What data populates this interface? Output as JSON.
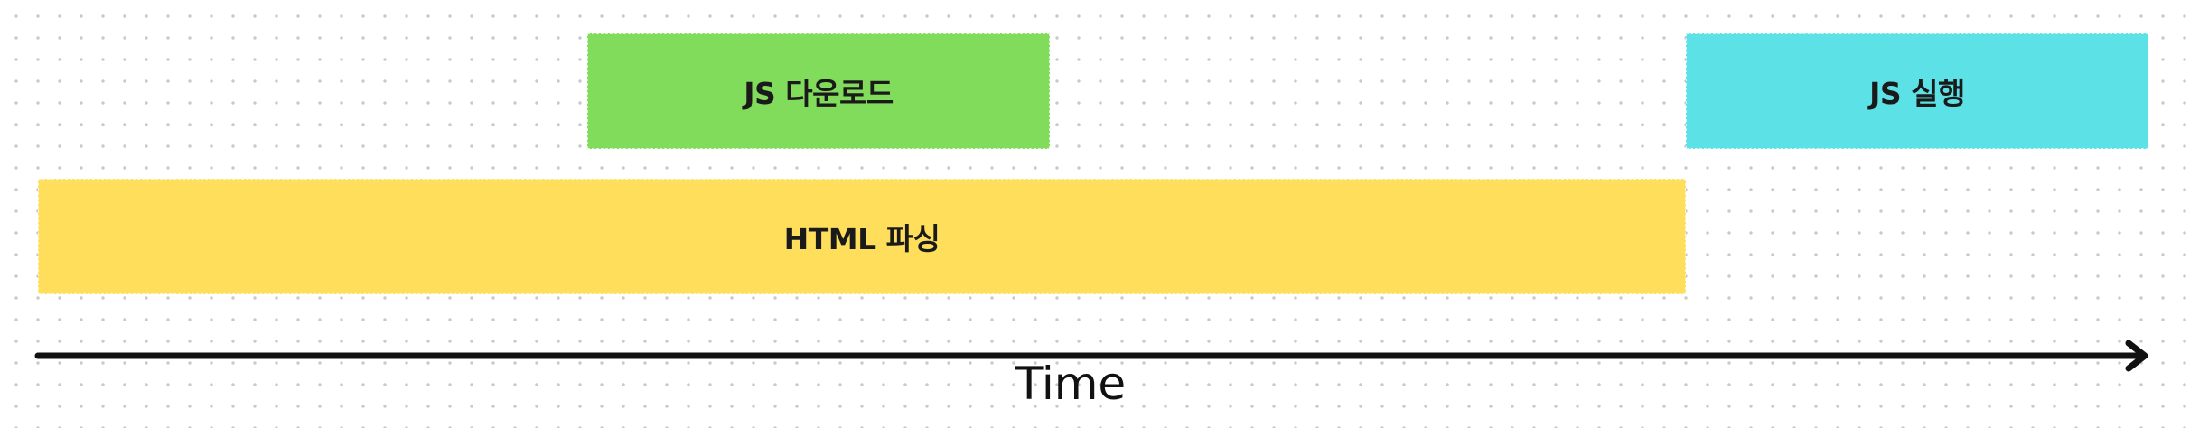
{
  "diagram": {
    "bars": {
      "js_download": {
        "label": "JS 다운로드",
        "color": "#82dc5c"
      },
      "js_execute": {
        "label": "JS 실행",
        "color": "#5ce1e6"
      },
      "html_parse": {
        "label": "HTML 파싱",
        "color": "#ffde5b"
      }
    },
    "axis": {
      "label": "Time",
      "color": "#111111"
    }
  }
}
